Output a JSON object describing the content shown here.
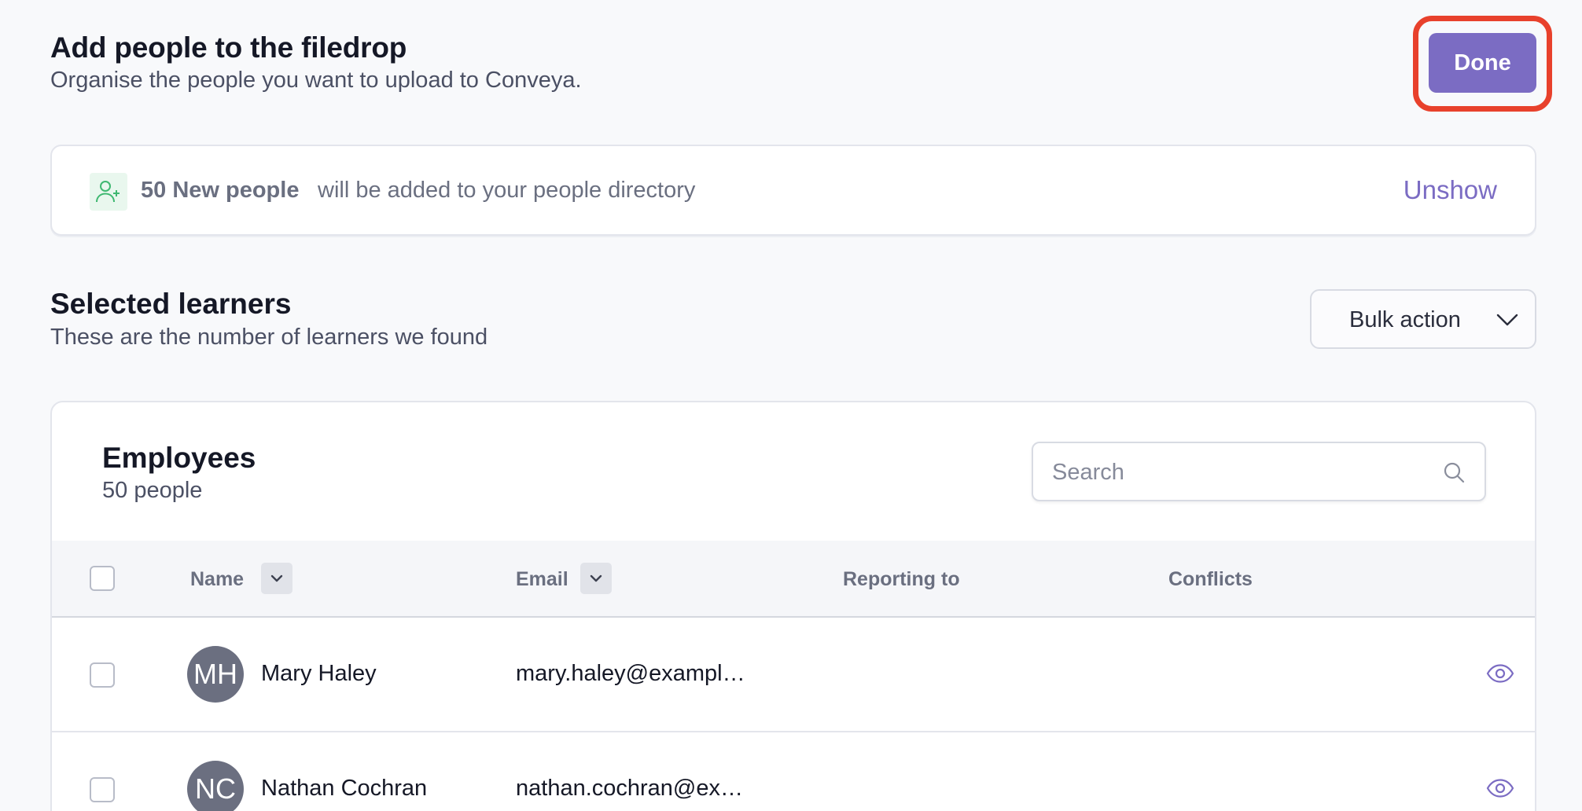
{
  "header": {
    "title": "Add people to the filedrop",
    "subtitle": "Organise the people you want to upload to Conveya.",
    "done_label": "Done"
  },
  "notice": {
    "icon": "user-plus-icon",
    "count_label": "50 New people",
    "message": "will be added to your people directory",
    "action_label": "Unshow"
  },
  "section": {
    "title": "Selected learners",
    "subtitle": "These are the number of learners we found",
    "bulk_action_label": "Bulk action"
  },
  "table": {
    "title": "Employees",
    "count_label": "50 people",
    "search_placeholder": "Search",
    "columns": [
      "Name",
      "Email",
      "Reporting to",
      "Conflicts"
    ],
    "rows": [
      {
        "initials": "MH",
        "name": "Mary Haley",
        "email": "mary.haley@exampl…",
        "reporting_to": "",
        "conflicts": ""
      },
      {
        "initials": "NC",
        "name": "Nathan Cochran",
        "email": "nathan.cochran@ex…",
        "reporting_to": "",
        "conflicts": ""
      }
    ]
  },
  "colors": {
    "accent": "#7b6cc3",
    "highlight": "#e8412c",
    "avatar": "#6b6f80",
    "success_bg": "#e9f7ee"
  }
}
